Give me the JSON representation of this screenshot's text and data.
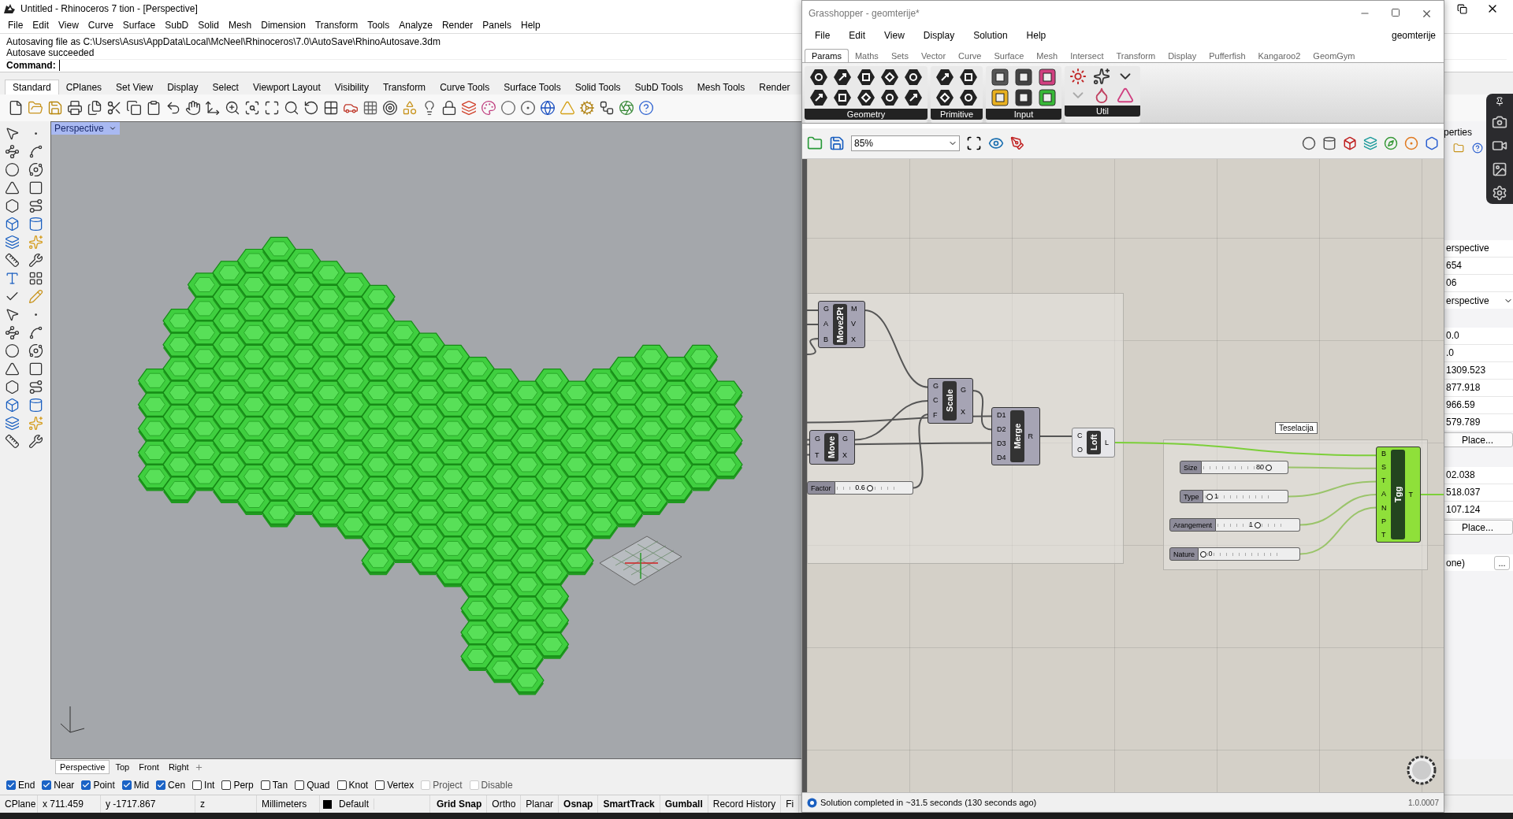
{
  "rhino": {
    "title": "Untitled - Rhinoceros 7 tion - [Perspective]",
    "menu": [
      "File",
      "Edit",
      "View",
      "Curve",
      "Surface",
      "SubD",
      "Solid",
      "Mesh",
      "Dimension",
      "Transform",
      "Tools",
      "Analyze",
      "Render",
      "Panels",
      "Help"
    ],
    "command_history": [
      "Autosaving file as C:\\Users\\Asus\\AppData\\Local\\McNeel\\Rhinoceros\\7.0\\AutoSave\\RhinoAutosave.3dm",
      "Autosave succeeded"
    ],
    "command_label": "Command:",
    "toolbar_tabs": [
      {
        "label": "Standard",
        "selected": true
      },
      {
        "label": "CPlanes",
        "selected": false
      },
      {
        "label": "Set View",
        "selected": false
      },
      {
        "label": "Display",
        "selected": false
      },
      {
        "label": "Select",
        "selected": false
      },
      {
        "label": "Viewport Layout",
        "selected": false
      },
      {
        "label": "Visibility",
        "selected": false
      },
      {
        "label": "Transform",
        "selected": false
      },
      {
        "label": "Curve Tools",
        "selected": false
      },
      {
        "label": "Surface Tools",
        "selected": false
      },
      {
        "label": "Solid Tools",
        "selected": false
      },
      {
        "label": "SubD Tools",
        "selected": false
      },
      {
        "label": "Mesh Tools",
        "selected": false
      },
      {
        "label": "Render",
        "selected": false
      }
    ],
    "viewport": {
      "title": "Perspective",
      "tabs": [
        {
          "label": "Perspective",
          "selected": true
        },
        {
          "label": "Top",
          "selected": false
        },
        {
          "label": "Front",
          "selected": false
        },
        {
          "label": "Right",
          "selected": false
        }
      ]
    },
    "osnaps": [
      {
        "label": "End",
        "checked": true,
        "disabled": false
      },
      {
        "label": "Near",
        "checked": true,
        "disabled": false
      },
      {
        "label": "Point",
        "checked": true,
        "disabled": false
      },
      {
        "label": "Mid",
        "checked": true,
        "disabled": false
      },
      {
        "label": "Cen",
        "checked": true,
        "disabled": false
      },
      {
        "label": "Int",
        "checked": false,
        "disabled": false
      },
      {
        "label": "Perp",
        "checked": false,
        "disabled": false
      },
      {
        "label": "Tan",
        "checked": false,
        "disabled": false
      },
      {
        "label": "Quad",
        "checked": false,
        "disabled": false
      },
      {
        "label": "Knot",
        "checked": false,
        "disabled": false
      },
      {
        "label": "Vertex",
        "checked": false,
        "disabled": false
      },
      {
        "label": "Project",
        "checked": false,
        "disabled": true
      },
      {
        "label": "Disable",
        "checked": false,
        "disabled": true
      }
    ],
    "status_bar": {
      "cplane": "CPlane",
      "x": "x 711.459",
      "y": "y -1717.867",
      "z": "z",
      "units": "Millimeters",
      "layer": {
        "name": "Default",
        "color": "#000000"
      },
      "toggles": [
        {
          "label": "Grid Snap",
          "on": true
        },
        {
          "label": "Ortho",
          "on": false
        },
        {
          "label": "Planar",
          "on": false
        },
        {
          "label": "Osnap",
          "on": true
        },
        {
          "label": "SmartTrack",
          "on": true
        },
        {
          "label": "Gumball",
          "on": true
        },
        {
          "label": "Record History",
          "on": false
        },
        {
          "label": "Fi",
          "on": false
        }
      ]
    },
    "properties": {
      "heading": "perties",
      "sections": [
        {
          "rows": [
            {
              "kind": "field",
              "text": "erspective"
            },
            {
              "kind": "field",
              "text": "654"
            },
            {
              "kind": "field",
              "text": "06"
            },
            {
              "kind": "dropdown",
              "text": "erspective"
            }
          ]
        },
        {
          "rows": [
            {
              "kind": "field",
              "text": "0.0"
            },
            {
              "kind": "field",
              "text": ".0"
            },
            {
              "kind": "field",
              "text": "1309.523"
            },
            {
              "kind": "field",
              "text": "877.918"
            },
            {
              "kind": "field",
              "text": "966.59"
            },
            {
              "kind": "field",
              "text": "579.789"
            },
            {
              "kind": "button",
              "text": "Place..."
            }
          ]
        },
        {
          "rows": [
            {
              "kind": "field",
              "text": "02.038"
            },
            {
              "kind": "field",
              "text": "518.037"
            },
            {
              "kind": "field",
              "text": "107.124"
            },
            {
              "kind": "button",
              "text": "Place..."
            }
          ]
        },
        {
          "rows": [
            {
              "kind": "more",
              "text": "one)",
              "button": "..."
            }
          ]
        }
      ]
    }
  },
  "grasshopper": {
    "title": "Grasshopper - geomterije*",
    "menu": [
      "File",
      "Edit",
      "View",
      "Display",
      "Solution",
      "Help"
    ],
    "document": "geomterije",
    "tabs": [
      {
        "label": "Params",
        "selected": true
      },
      {
        "label": "Maths",
        "selected": false
      },
      {
        "label": "Sets",
        "selected": false
      },
      {
        "label": "Vector",
        "selected": false
      },
      {
        "label": "Curve",
        "selected": false
      },
      {
        "label": "Surface",
        "selected": false
      },
      {
        "label": "Mesh",
        "selected": false
      },
      {
        "label": "Intersect",
        "selected": false
      },
      {
        "label": "Transform",
        "selected": false
      },
      {
        "label": "Display",
        "selected": false
      },
      {
        "label": "Pufferfish",
        "selected": false
      },
      {
        "label": "Kangaroo2",
        "selected": false
      },
      {
        "label": "GeomGym",
        "selected": false
      }
    ],
    "ribbon_groups": [
      {
        "label": "Geometry"
      },
      {
        "label": "Primitive"
      },
      {
        "label": "Input"
      },
      {
        "label": "Util"
      }
    ],
    "zoom": "85%",
    "group_label": "Teselacija",
    "components": [
      {
        "name": "Move2Pt",
        "inputs": [
          "G",
          "A",
          "B"
        ],
        "outputs": [
          "M",
          "V",
          "X"
        ],
        "selected": false,
        "preview": false
      },
      {
        "name": "Scale",
        "inputs": [
          "G",
          "C",
          "F"
        ],
        "outputs": [
          "G",
          "X"
        ],
        "selected": false,
        "preview": false
      },
      {
        "name": "Move",
        "inputs": [
          "G",
          "T"
        ],
        "outputs": [
          "G",
          "X"
        ],
        "selected": false,
        "preview": false
      },
      {
        "name": "Merge",
        "inputs": [
          "D1",
          "D2",
          "D3",
          "D4"
        ],
        "outputs": [
          "R"
        ],
        "selected": false,
        "preview": false
      },
      {
        "name": "Loft",
        "inputs": [
          "C",
          "O"
        ],
        "outputs": [
          "L"
        ],
        "selected": false,
        "preview": true
      },
      {
        "name": "Tgg",
        "inputs": [
          "B",
          "S",
          "T",
          "A",
          "N",
          "P",
          "T"
        ],
        "outputs": [
          "T"
        ],
        "selected": true,
        "preview": false
      }
    ],
    "sliders": [
      {
        "label": "Factor",
        "value": "0.6",
        "level": 0.45
      },
      {
        "label": "Size",
        "value": "80",
        "level": 0.78
      },
      {
        "label": "Type",
        "value": "1",
        "level": 0.08
      },
      {
        "label": "Arangement",
        "value": "1",
        "level": 0.5
      },
      {
        "label": "Nature",
        "value": "0",
        "level": 0.05
      }
    ],
    "status": "Solution completed in ~31.5 seconds (130 seconds ago)",
    "version": "1.0.0007"
  }
}
